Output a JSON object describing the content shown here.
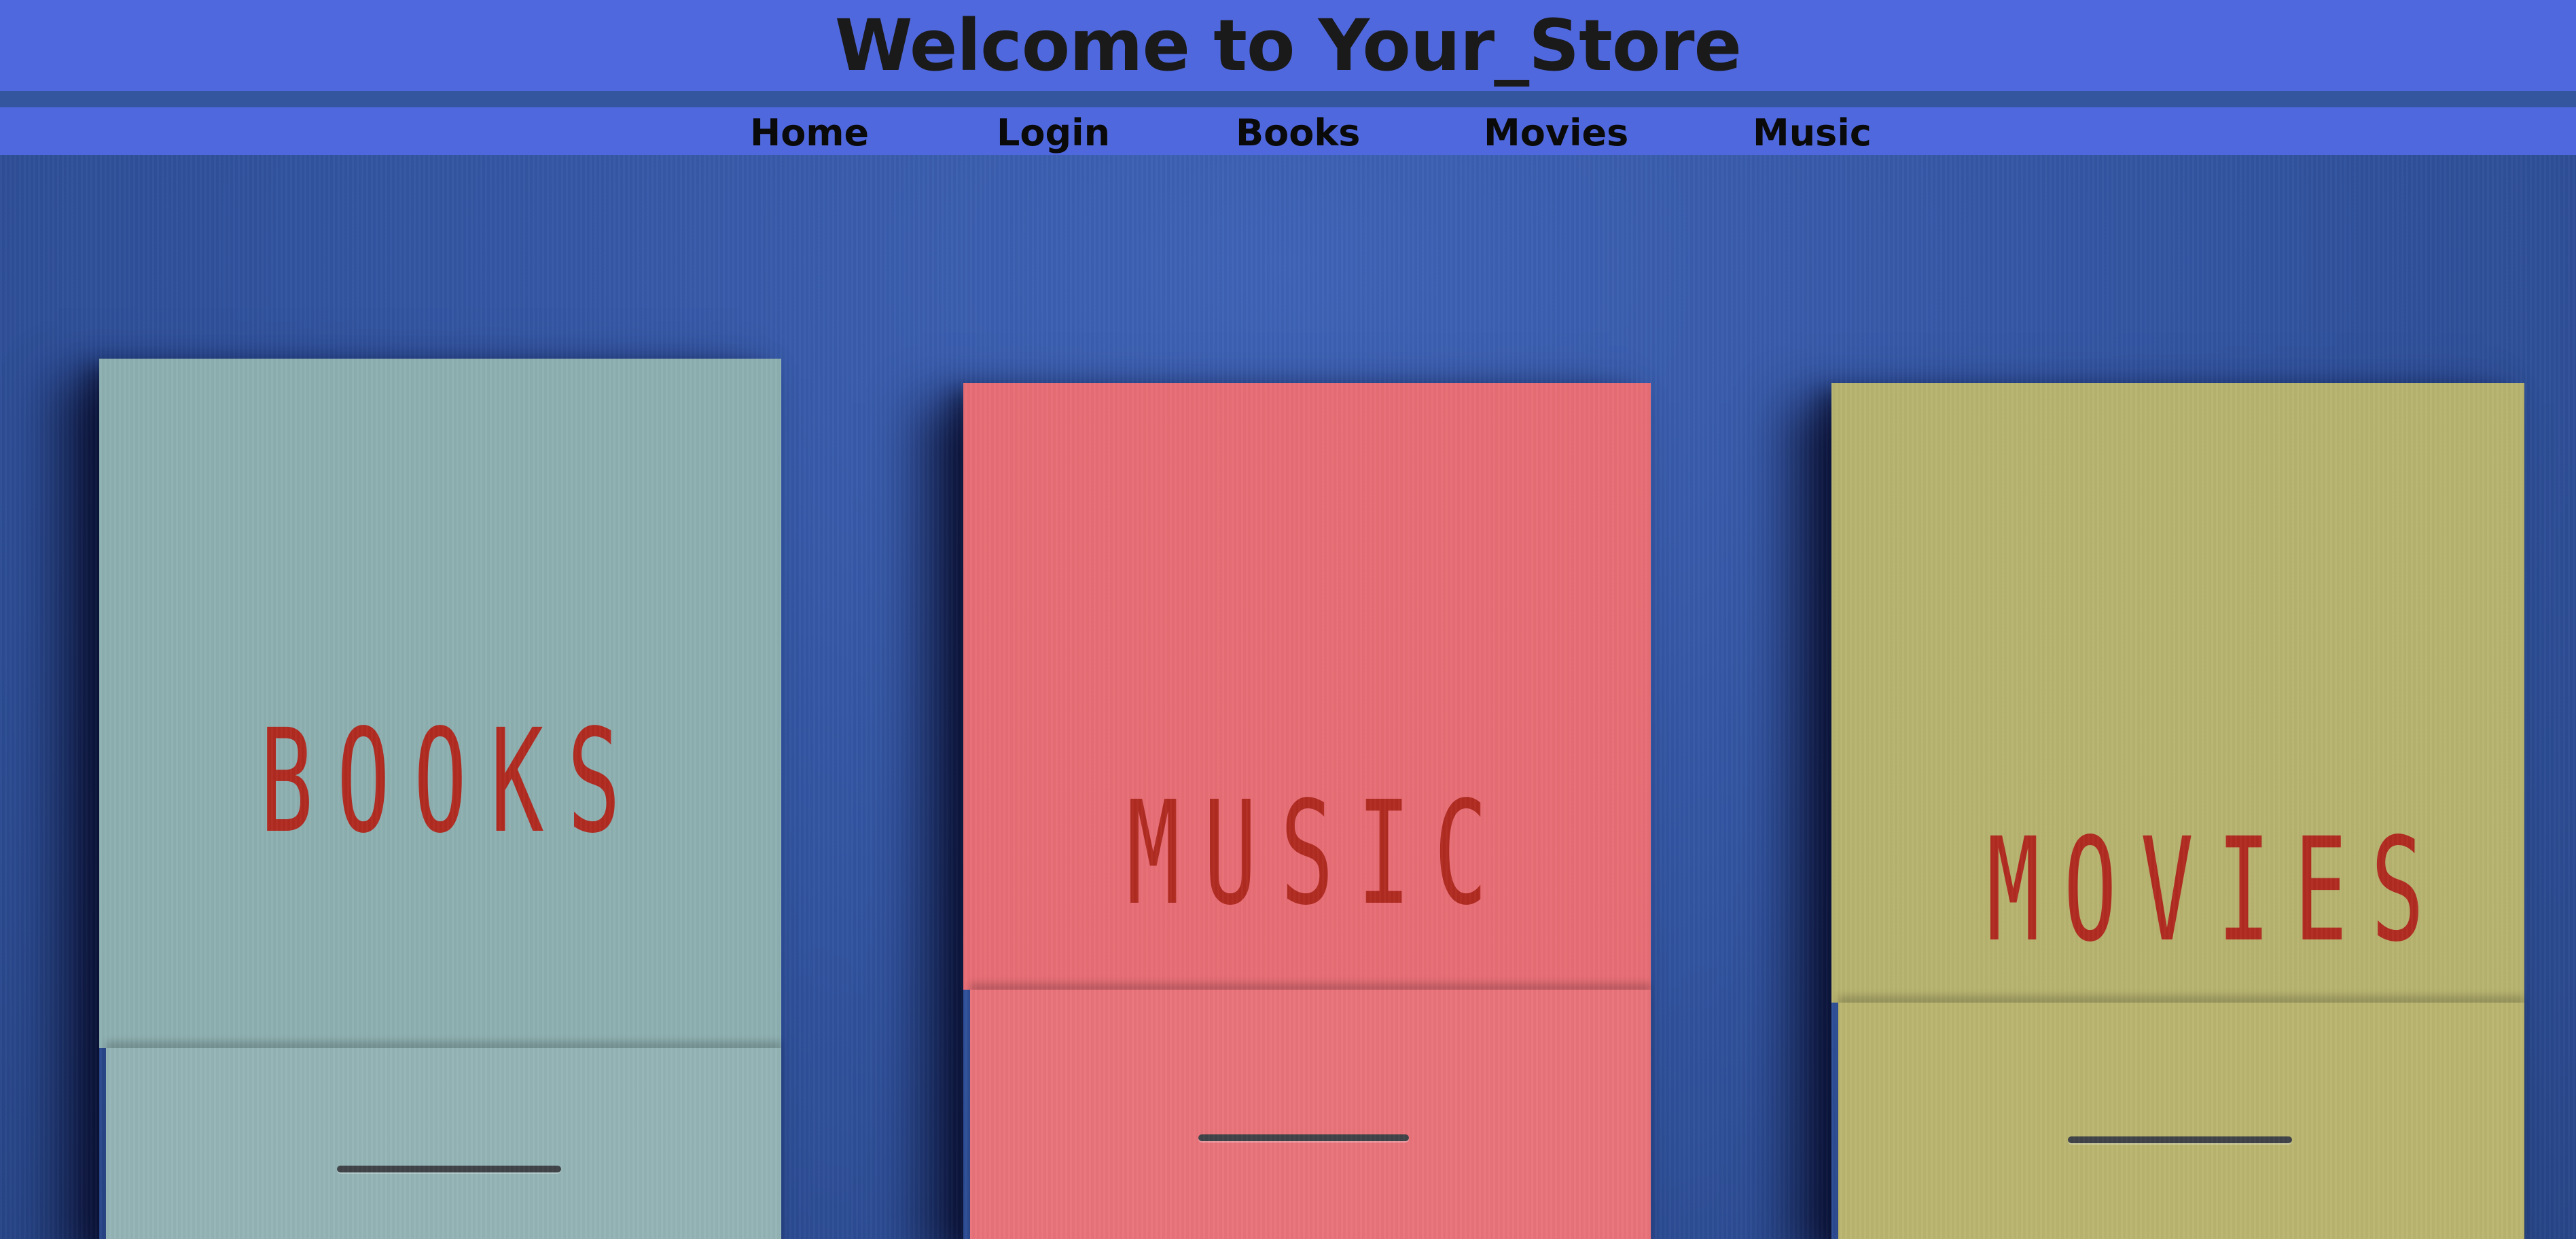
{
  "header": {
    "title": "Welcome to Your_Store"
  },
  "nav": {
    "items": [
      {
        "label": "Home"
      },
      {
        "label": "Login"
      },
      {
        "label": "Books"
      },
      {
        "label": "Movies"
      },
      {
        "label": "Music"
      }
    ]
  },
  "hero": {
    "matchbooks": [
      {
        "label": "BOOKS"
      },
      {
        "label": "MUSIC"
      },
      {
        "label": "MOVIES"
      }
    ]
  },
  "colors": {
    "header_background": "#5068de",
    "divider": "#34569f",
    "text": "#1a1a1a",
    "books_cover": "#8eb0b1",
    "music_cover": "#e86e76",
    "movies_cover": "#b7b36f",
    "label_red": "#b12b22"
  }
}
